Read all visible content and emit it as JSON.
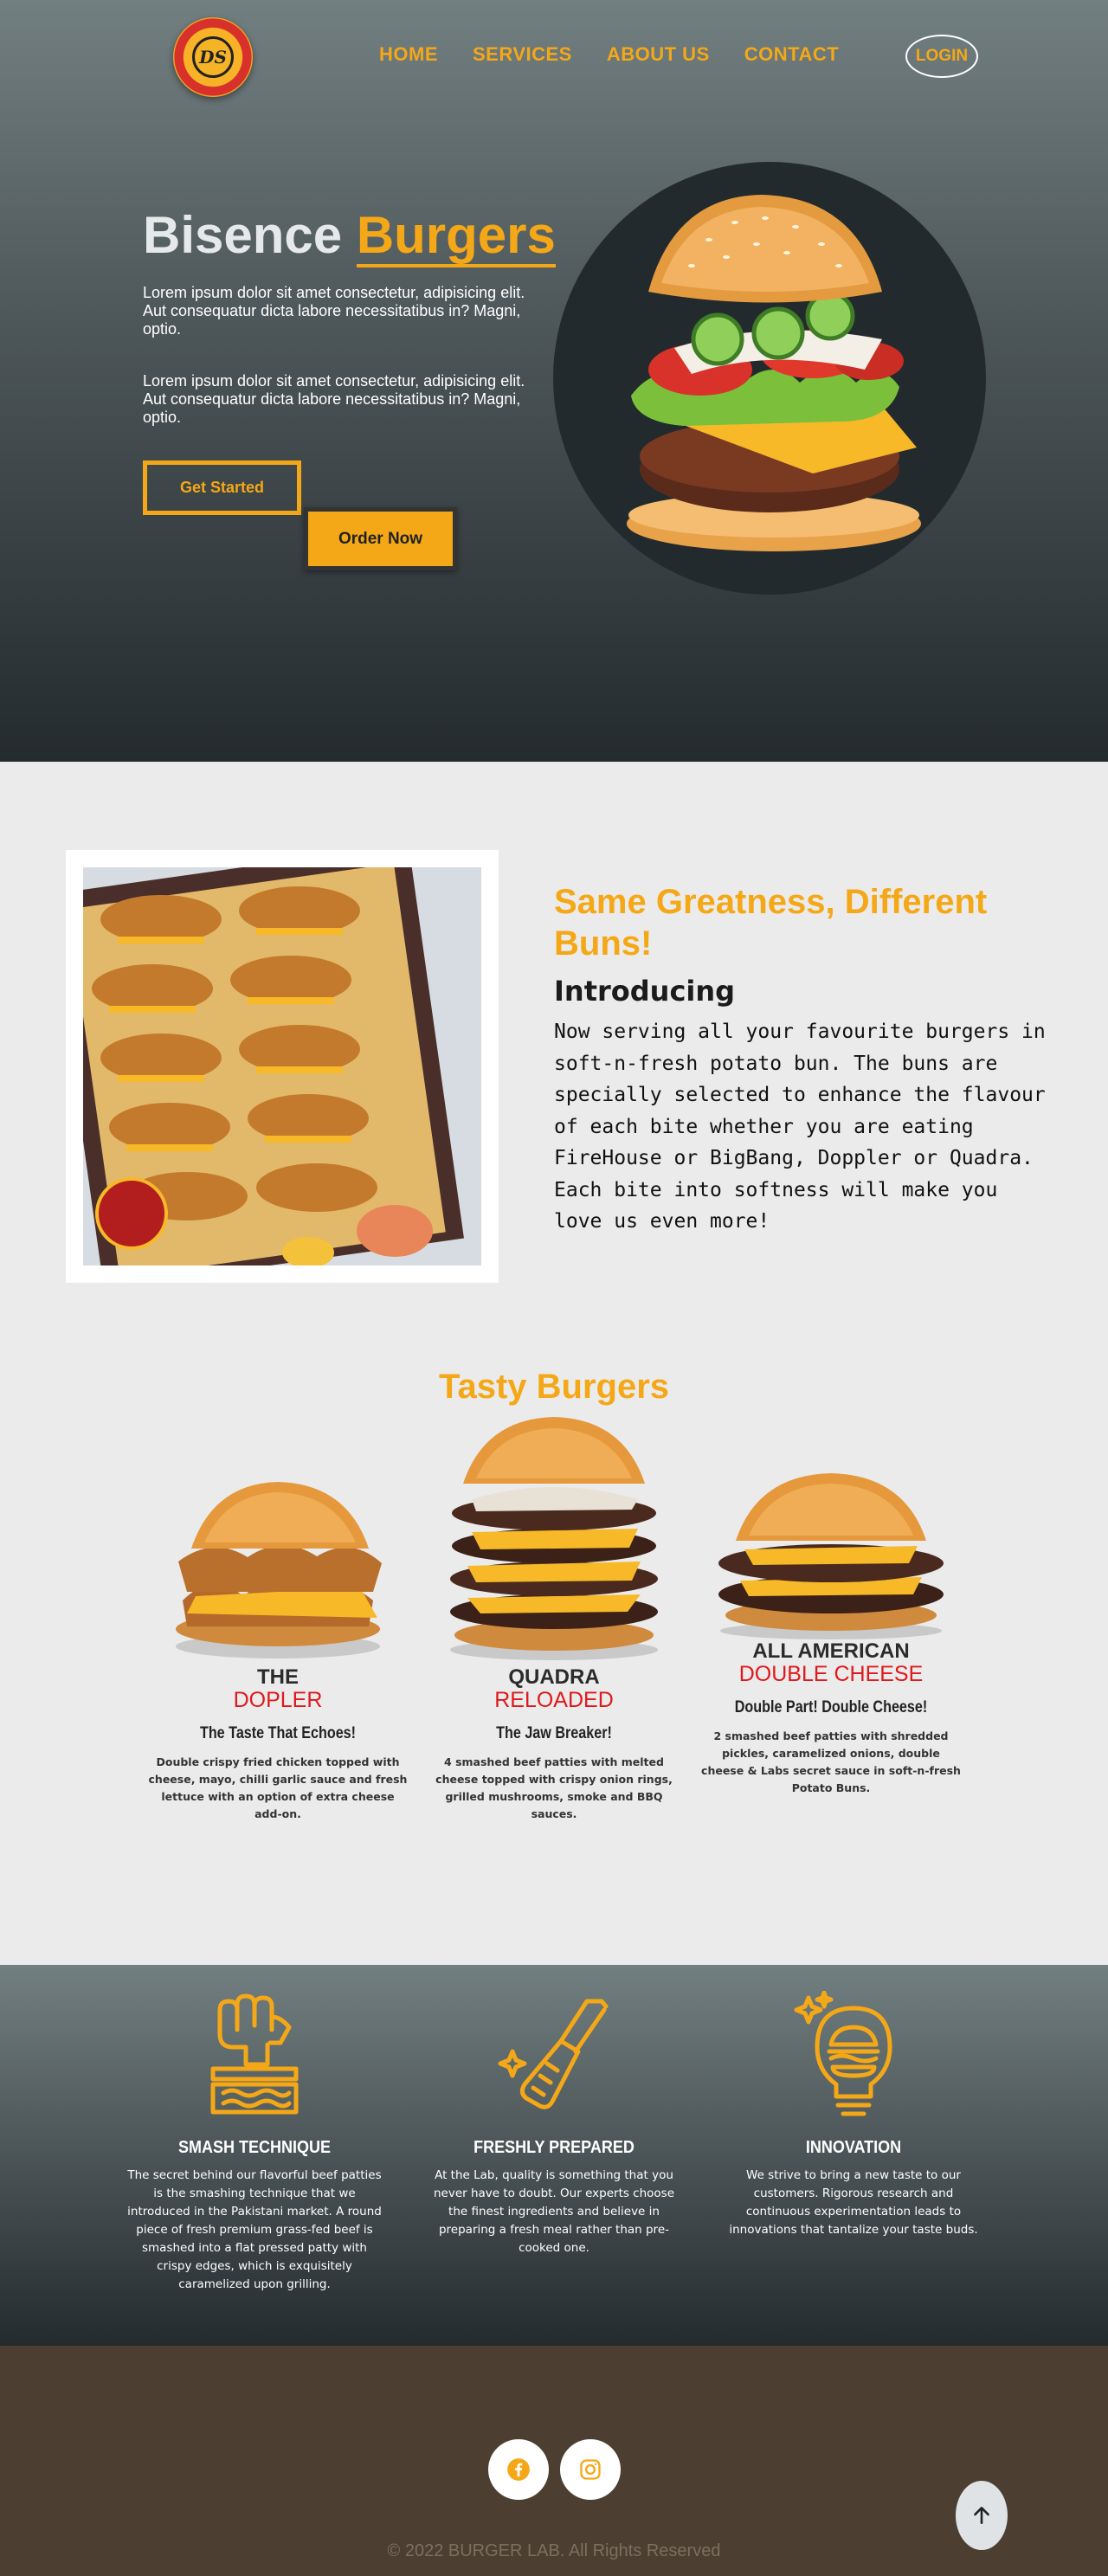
{
  "header": {
    "logo_text": "DS",
    "nav": [
      "HOME",
      "SERVICES",
      "ABOUT US",
      "CONTACT"
    ],
    "login_label": "LOGIN"
  },
  "hero": {
    "title_part1": "Bisence",
    "title_part2": "Burgers",
    "paragraph1": "Lorem ipsum dolor sit amet consectetur, adipisicing elit. Aut consequatur dicta labore necessitatibus in? Magni, optio.",
    "paragraph2": "Lorem ipsum dolor sit amet consectetur, adipisicing elit. Aut consequatur dicta labore necessitatibus in? Magni, optio.",
    "get_started_label": "Get Started",
    "order_now_label": "Order Now"
  },
  "intro": {
    "heading": "Same Greatness, Different Buns!",
    "subheading": "Introducing",
    "text": "Now serving all your favourite burgers in soft-n-fresh potato bun. The buns are specially selected to enhance the flavour of each bite whether you are eating FireHouse or BigBang, Doppler or Quadra. Each bite into softness will make you love us even more!"
  },
  "burgers": {
    "title": "Tasty Burgers",
    "items": [
      {
        "name": "THE",
        "variant": "DOPLER",
        "tagline": "The Taste That Echoes!",
        "description": "Double crispy fried chicken topped with cheese, mayo, chilli garlic sauce and fresh lettuce with an option of extra cheese add-on."
      },
      {
        "name": "QUADRA",
        "variant": "RELOADED",
        "tagline": "The Jaw Breaker!",
        "description": "4 smashed beef patties with melted cheese topped with crispy onion rings, grilled mushrooms, smoke and BBQ sauces."
      },
      {
        "name": "ALL AMERICAN",
        "variant": "DOUBLE CHEESE",
        "tagline": "Double Part! Double Cheese!",
        "description": "2 smashed beef patties with shredded pickles, caramelized onions, double cheese & Labs secret sauce in soft-n-fresh Potato Buns."
      }
    ]
  },
  "features": [
    {
      "icon": "smash-icon",
      "title": "SMASH TECHNIQUE",
      "text": "The secret behind our flavorful beef patties is the smashing technique that we introduced in the Pakistani market. A round piece of fresh premium grass-fed beef is smashed into a flat pressed patty with crispy edges, which is exquisitely caramelized upon grilling."
    },
    {
      "icon": "spatula-icon",
      "title": "FRESHLY PREPARED",
      "text": "At the Lab, quality is something that you never have to doubt. Our experts choose the finest ingredients and believe in preparing a fresh meal rather than pre-cooked one."
    },
    {
      "icon": "lightbulb-burger-icon",
      "title": "INNOVATION",
      "text": "We strive to bring a new taste to our customers. Rigorous research and continuous experimentation leads to innovations that tantalize your taste buds."
    }
  ],
  "footer": {
    "copyright": "© 2022 BURGER LAB. All Rights Reserved"
  },
  "colors": {
    "accent": "#f5a817",
    "red": "#e0191c",
    "footer_bg": "#4c3f31"
  }
}
